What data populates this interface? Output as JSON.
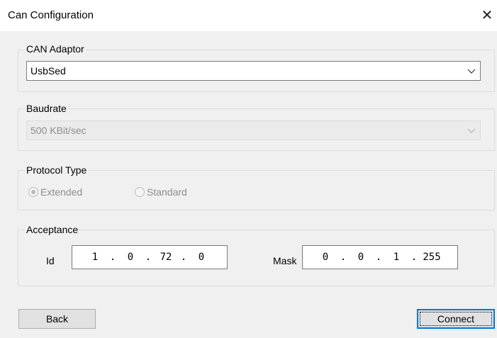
{
  "window": {
    "title": "Can Configuration",
    "close_glyph": "✕"
  },
  "can_adaptor": {
    "legend": "CAN Adaptor",
    "selected": "UsbSed"
  },
  "baudrate": {
    "legend": "Baudrate",
    "selected": "500 KBit/sec"
  },
  "protocol_type": {
    "legend": "Protocol Type",
    "options": [
      {
        "label": "Extended",
        "checked": true
      },
      {
        "label": "Standard",
        "checked": false
      }
    ]
  },
  "acceptance": {
    "legend": "Acceptance",
    "id_label": "Id",
    "id_octets": [
      "1",
      "0",
      "72",
      "0"
    ],
    "mask_label": "Mask",
    "mask_octets": [
      "0",
      "0",
      "1",
      "255"
    ]
  },
  "buttons": {
    "back": "Back",
    "connect": "Connect"
  },
  "colors": {
    "accent": "#0078d7",
    "disabled_text": "#8d8d8d"
  }
}
